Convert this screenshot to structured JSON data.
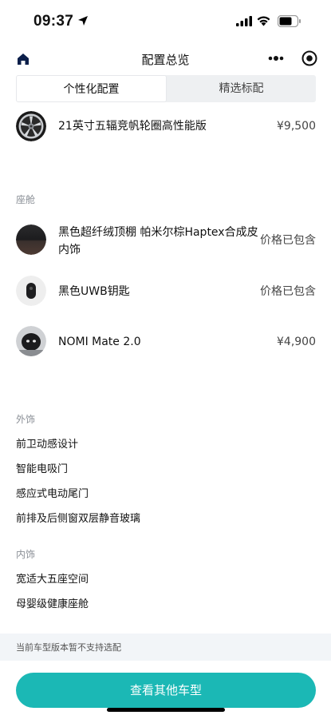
{
  "status": {
    "time": "09:37"
  },
  "nav": {
    "title": "配置总览"
  },
  "tabs": [
    {
      "label": "个性化配置",
      "active": true
    },
    {
      "label": "精选标配",
      "active": false
    }
  ],
  "wheel": {
    "name": "21英寸五辐竞帆轮圈高性能版",
    "price": "¥9,500"
  },
  "cabin": {
    "label": "座舱",
    "items": [
      {
        "name": "黑色超纤绒顶棚 帕米尔棕Haptex合成皮内饰",
        "price": "价格已包含"
      },
      {
        "name": "黑色UWB钥匙",
        "price": "价格已包含"
      },
      {
        "name": "NOMI Mate 2.0",
        "price": "¥4,900"
      }
    ]
  },
  "exterior": {
    "label": "外饰",
    "items": [
      "前卫动感设计",
      "智能电吸门",
      "感应式电动尾门",
      "前排及后侧窗双层静音玻璃"
    ]
  },
  "interior": {
    "label": "内饰",
    "items": [
      "宽适大五座空间",
      "母婴级健康座舱"
    ]
  },
  "notice": "当前车型版本暂不支持选配",
  "cta": "查看其他车型",
  "colors": {
    "accent": "#1bb8b5"
  }
}
